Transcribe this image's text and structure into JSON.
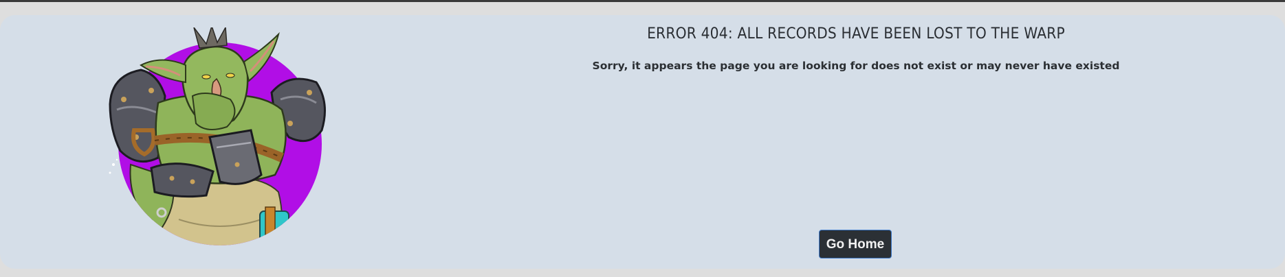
{
  "error": {
    "title": "ERROR 404: ALL RECORDS HAVE BEEN LOST TO THE WARP",
    "message": "Sorry, it appears the page you are looking for does not exist or may never have existed"
  },
  "actions": {
    "home_label": "Go Home"
  },
  "illustration": {
    "subject": "armored goblin character portrait",
    "backdrop_color": "#b10ee6"
  },
  "colors": {
    "page_bg": "#dedede",
    "card_bg": "#d5dee8",
    "button_bg": "#2b3035",
    "button_border": "#3d79c9"
  }
}
